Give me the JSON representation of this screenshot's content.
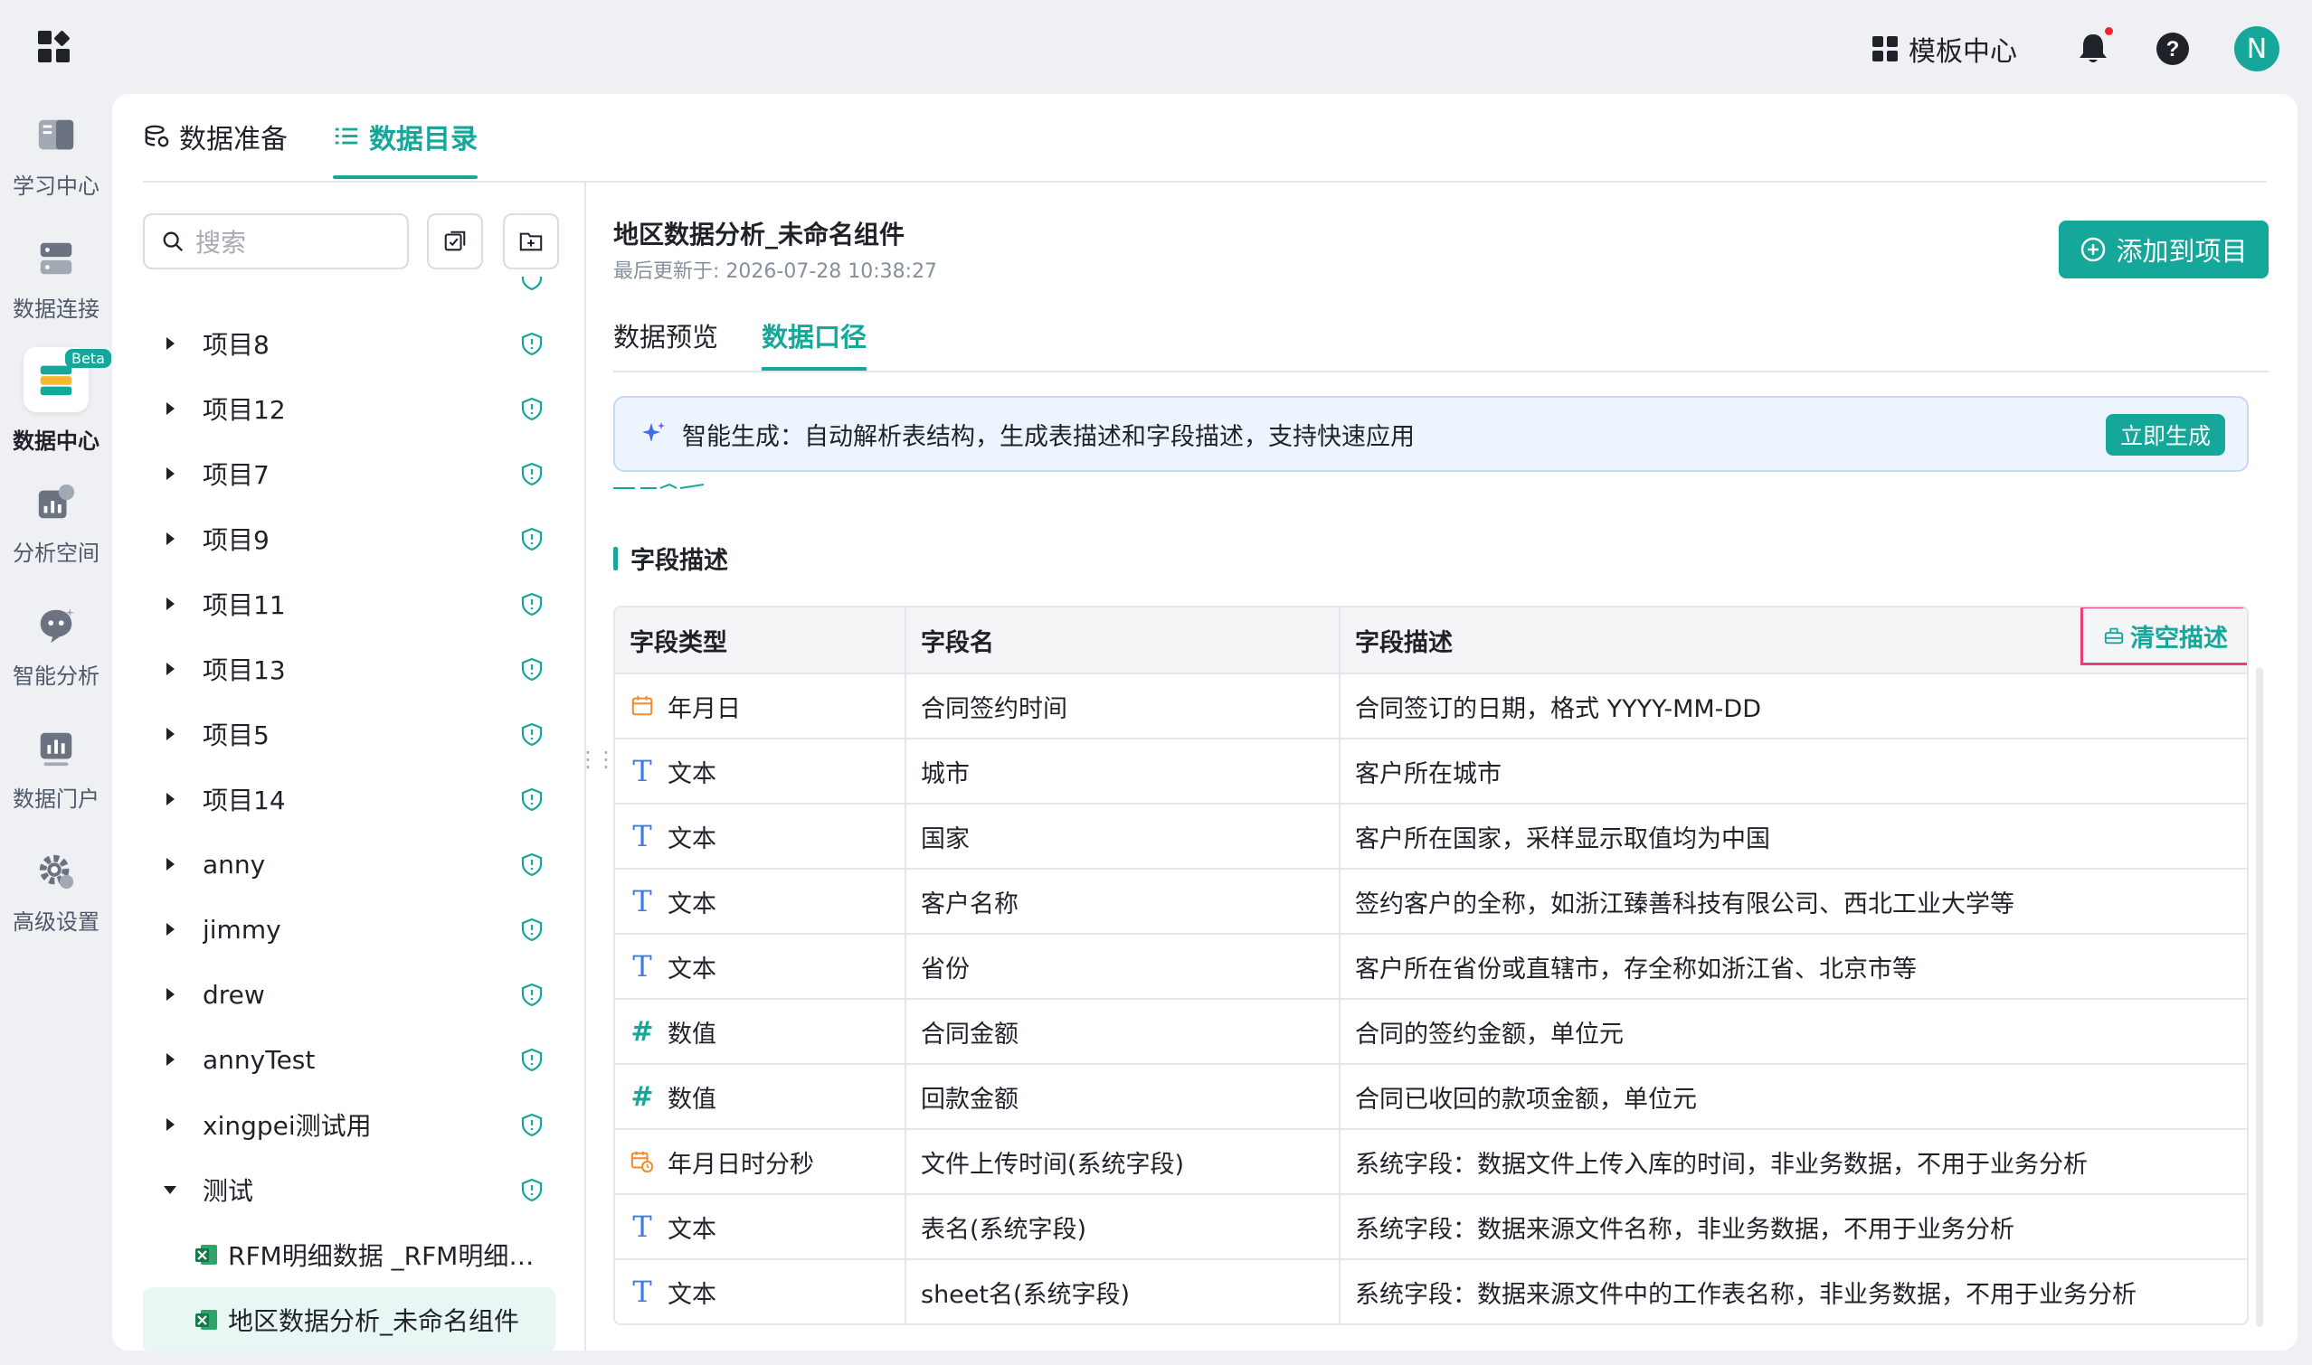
{
  "header": {
    "template_center": "模板中心",
    "avatar_letter": "N"
  },
  "leftnav": {
    "items": [
      {
        "label": "学习中心",
        "icon": "book-icon"
      },
      {
        "label": "数据连接",
        "icon": "database-icon"
      },
      {
        "label": "数据中心",
        "icon": "data-center-icon",
        "badge": "Beta",
        "active": true
      },
      {
        "label": "分析空间",
        "icon": "chart-icon"
      },
      {
        "label": "智能分析",
        "icon": "ai-bot-icon"
      },
      {
        "label": "数据门户",
        "icon": "portal-icon"
      },
      {
        "label": "高级设置",
        "icon": "gear-icon"
      }
    ]
  },
  "main_tabs": [
    {
      "label": "数据准备",
      "icon": "data-prep-icon"
    },
    {
      "label": "数据目录",
      "icon": "list-icon",
      "active": true
    }
  ],
  "sidebar": {
    "search_placeholder": "搜索",
    "tree": [
      {
        "label": "项目8"
      },
      {
        "label": "项目12"
      },
      {
        "label": "项目7"
      },
      {
        "label": "项目9"
      },
      {
        "label": "项目11"
      },
      {
        "label": "项目13"
      },
      {
        "label": "项目5"
      },
      {
        "label": "项目14"
      },
      {
        "label": "anny"
      },
      {
        "label": "jimmy"
      },
      {
        "label": "drew"
      },
      {
        "label": "annyTest"
      },
      {
        "label": "xingpei测试用"
      },
      {
        "label": "测试",
        "expanded": true
      }
    ],
    "leaves": [
      {
        "label": "RFM明细数据 _RFM明细数据"
      },
      {
        "label": "地区数据分析_未命名组件",
        "selected": true
      }
    ]
  },
  "content": {
    "title": "地区数据分析_未命名组件",
    "updated": "最后更新于: 2026-07-28 10:38:27",
    "add_button": "添加到项目",
    "tabs": [
      "数据预览",
      "数据口径"
    ],
    "ai_banner": {
      "text": "智能生成：自动解析表结构，生成表描述和字段描述，支持快速应用",
      "button": "立即生成"
    },
    "section_title": "字段描述",
    "table": {
      "headers": [
        "字段类型",
        "字段名",
        "字段描述"
      ],
      "clear_button": "清空描述",
      "rows": [
        {
          "type_icon": "calendar-icon",
          "type": "年月日",
          "name": "合同签约时间",
          "desc": "合同签订的日期，格式 YYYY-MM-DD"
        },
        {
          "type_icon": "text-type-icon",
          "type": "文本",
          "name": "城市",
          "desc": "客户所在城市"
        },
        {
          "type_icon": "text-type-icon",
          "type": "文本",
          "name": "国家",
          "desc": "客户所在国家，采样显示取值均为中国"
        },
        {
          "type_icon": "text-type-icon",
          "type": "文本",
          "name": "客户名称",
          "desc": "签约客户的全称，如浙江臻善科技有限公司、西北工业大学等"
        },
        {
          "type_icon": "text-type-icon",
          "type": "文本",
          "name": "省份",
          "desc": "客户所在省份或直辖市，存全称如浙江省、北京市等"
        },
        {
          "type_icon": "number-type-icon",
          "type": "数值",
          "name": "合同金额",
          "desc": "合同的签约金额，单位元"
        },
        {
          "type_icon": "number-type-icon",
          "type": "数值",
          "name": "回款金额",
          "desc": "合同已收回的款项金额，单位元"
        },
        {
          "type_icon": "datetime-icon",
          "type": "年月日时分秒",
          "name": "文件上传时间(系统字段)",
          "desc": "系统字段：数据文件上传入库的时间，非业务数据，不用于业务分析"
        },
        {
          "type_icon": "text-type-icon",
          "type": "文本",
          "name": "表名(系统字段)",
          "desc": "系统字段：数据来源文件名称，非业务数据，不用于业务分析"
        },
        {
          "type_icon": "text-type-icon",
          "type": "文本",
          "name": "sheet名(系统字段)",
          "desc": "系统字段：数据来源文件中的工作表名称，非业务数据，不用于业务分析"
        }
      ]
    }
  },
  "colors": {
    "accent": "#14a79a",
    "highlight_border": "#e83e79",
    "text_icon": "#3f7be6",
    "date_icon": "#f08c2e"
  }
}
